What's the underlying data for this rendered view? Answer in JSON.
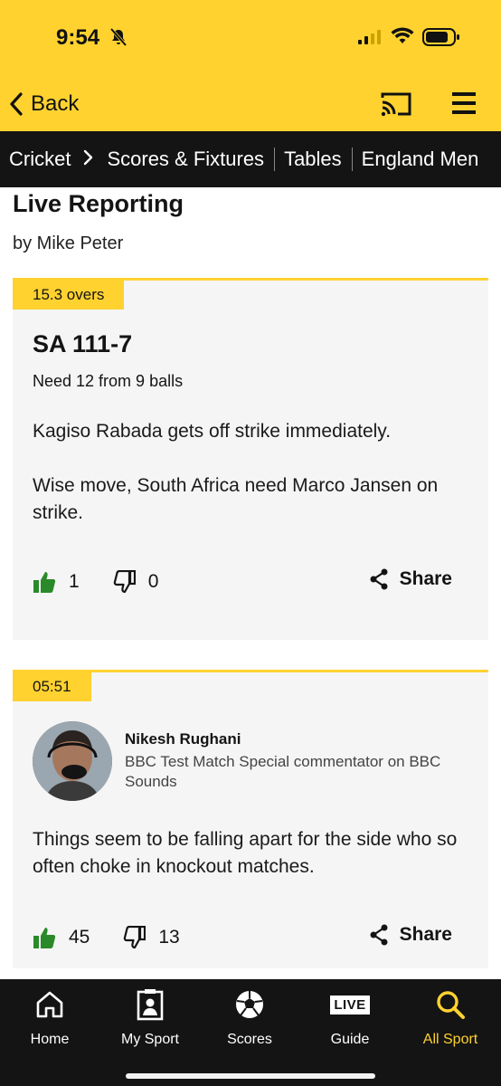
{
  "status_bar": {
    "time": "9:54"
  },
  "nav": {
    "back_label": "Back"
  },
  "breadcrumbs": [
    "Cricket",
    "Scores & Fixtures",
    "Tables",
    "England Men"
  ],
  "page": {
    "title": "Live Reporting",
    "byline": "by Mike Peter"
  },
  "posts": [
    {
      "tag": "15.3 overs",
      "score": "SA 111-7",
      "need": "Need 12 from 9 balls",
      "paragraphs": [
        "Kagiso Rabada gets off strike immediately.",
        "Wise move, South Africa need Marco Jansen on strike."
      ],
      "likes": "1",
      "dislikes": "0",
      "share_label": "Share"
    },
    {
      "tag": "05:51",
      "author": "Nikesh Rughani",
      "role": "BBC Test Match Special commentator on BBC Sounds",
      "paragraphs": [
        "Things seem to be falling apart for the side who so often choke in knockout matches."
      ],
      "likes": "45",
      "dislikes": "13",
      "share_label": "Share"
    }
  ],
  "tabs": [
    {
      "label": "Home",
      "icon": "home-icon"
    },
    {
      "label": "My Sport",
      "icon": "profile-card-icon"
    },
    {
      "label": "Scores",
      "icon": "football-icon"
    },
    {
      "label": "Guide",
      "icon": "live-icon",
      "badge": "LIVE"
    },
    {
      "label": "All Sport",
      "icon": "search-icon",
      "active": true
    }
  ],
  "colors": {
    "accent": "#FFD230",
    "dark": "#141414",
    "like_green": "#2a8a2a"
  }
}
